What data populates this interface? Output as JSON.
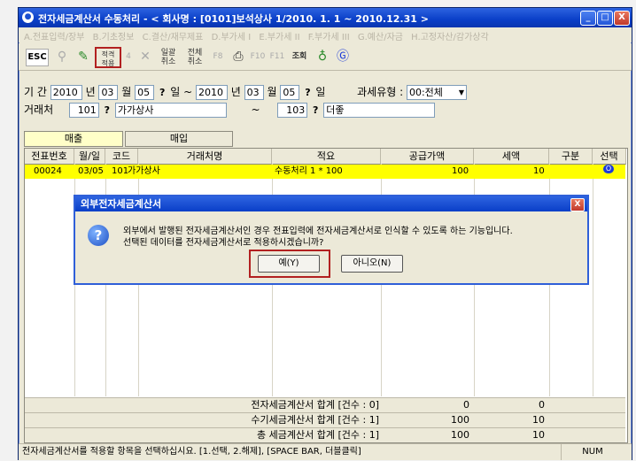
{
  "window": {
    "title": "전자세금계산서 수동처리 - < 회사명 : [0101]보석상사     1/2010. 1. 1 ~ 2010.12.31 >",
    "controls": {
      "minimize": "_",
      "maximize": "□",
      "close": "X"
    }
  },
  "menu": {
    "items": [
      "A.전표입력/장부",
      "B.기초정보",
      "C.결산/재무제표",
      "D.부가세 I",
      "E.부가세 II",
      "F.부가세 III",
      "G.예산/자금",
      "H.고정자산/감가상각"
    ]
  },
  "toolbar": {
    "esc": "ESC",
    "apply_line1": "적격",
    "apply_line2": "적용",
    "f4": "4",
    "all_cancel": "일괄 취소",
    "all_apply": "전체 취소",
    "f8": "F8",
    "f10": "F10",
    "f11": "F11",
    "search": "조회"
  },
  "filters": {
    "period_label": "기  간",
    "start_year": "2010",
    "year_unit": "년",
    "start_month": "03",
    "month_unit": "월",
    "start_day": "05",
    "day_unit": "일",
    "tilde": "~",
    "end_year": "2010",
    "end_month": "03",
    "end_day": "05",
    "tax_type_label": "과세유형 :",
    "tax_type_value": "00:전체",
    "client_label": "거래처",
    "client_from_code": "101",
    "client_from_name": "가가상사",
    "client_to_code": "103",
    "client_to_name": "더좋"
  },
  "tabs": {
    "sales": "매출",
    "purchase": "매입"
  },
  "grid": {
    "columns": [
      "전표번호",
      "월/일",
      "코드",
      "거래처명",
      "적요",
      "공급가액",
      "세액",
      "구분",
      "선택"
    ],
    "rows": [
      {
        "voucher": "00024",
        "date": "03/05",
        "code": "101",
        "client": "가가상사",
        "desc": "수동처리 1 * 100",
        "supply": "100",
        "tax": "10",
        "type": "",
        "select": "O"
      }
    ],
    "summary": [
      {
        "label": "전자세금계산서 합계 [건수 : 0]",
        "supply": "0",
        "tax": "0"
      },
      {
        "label": "수기세금계산서 합계 [건수 : 1]",
        "supply": "100",
        "tax": "10"
      },
      {
        "label": "총  세금계산서 합계 [건수 : 1]",
        "supply": "100",
        "tax": "10"
      }
    ]
  },
  "dialog": {
    "title": "외부전자세금계산서",
    "close": "X",
    "line1": "외부에서 발행된 전자세금계산서인 경우 전표입력에 전자세금계산서로 인식할 수 있도록 하는 기능입니다.",
    "line2": "선택된 데이터를 전자세금계산서로 적용하시겠습니까?",
    "yes": "예(Y)",
    "no": "아니오(N)"
  },
  "statusbar": {
    "message": "전자세금계산서를 적용할 항목을 선택하십시요. [1.선택, 2.해제], [SPACE BAR, 더블클릭]",
    "num": "NUM"
  },
  "colors": {
    "title_bar": "#0a3fc8",
    "highlight_row": "#ffff00",
    "annotation": "#b22020"
  }
}
